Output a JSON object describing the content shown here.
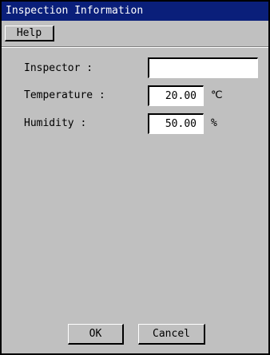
{
  "window": {
    "title": "Inspection Information"
  },
  "menubar": {
    "help_label": "Help"
  },
  "form": {
    "inspector": {
      "label": "Inspector :",
      "value": ""
    },
    "temperature": {
      "label": "Temperature :",
      "value": "20.00",
      "unit": "℃"
    },
    "humidity": {
      "label": "Humidity :",
      "value": "50.00",
      "unit": "%"
    }
  },
  "buttons": {
    "ok_label": "OK",
    "cancel_label": "Cancel"
  },
  "colors": {
    "titlebar_bg": "#0a1f7a",
    "window_bg": "#c0c0c0",
    "field_bg": "#ffffff"
  }
}
